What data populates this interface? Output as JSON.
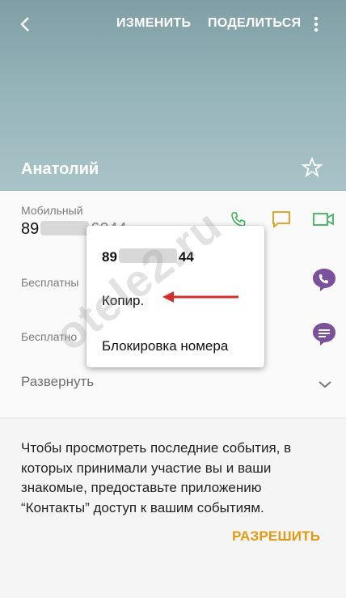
{
  "header": {
    "edit_label": "ИЗМЕНИТЬ",
    "share_label": "ПОДЕЛИТЬСЯ",
    "contact_name": "Анатолий"
  },
  "phone_card": {
    "mobile_label": "Мобильный",
    "number_prefix": "89",
    "number_suffix": "6044",
    "free_label_1": "Бесплатны",
    "free_label_2": "Бесплатно",
    "expand_label": "Развернуть"
  },
  "popup": {
    "number_prefix": "89",
    "number_suffix": "44",
    "items": [
      "Копир.",
      "Блокировка номера"
    ]
  },
  "events": {
    "text": "Чтобы просмотреть последние события, в которых принимали участие вы и ваши знакомые, предоставьте приложению “Контакты” доступ к вашим событиям.",
    "allow_label": "РАЗРЕШИТЬ"
  },
  "watermark": "otele2.ru",
  "colors": {
    "header_top": "#7f9ea5",
    "accent_orange": "#e39a12",
    "green": "#3db45a",
    "viber_purple": "#7b519d",
    "arrow_red": "#d32f2f"
  },
  "icons": [
    "back-icon",
    "more-icon",
    "star-icon",
    "phone-icon",
    "message-icon",
    "video-icon",
    "viber-call-icon",
    "viber-message-icon",
    "chevron-down-icon",
    "arrow-icon"
  ]
}
